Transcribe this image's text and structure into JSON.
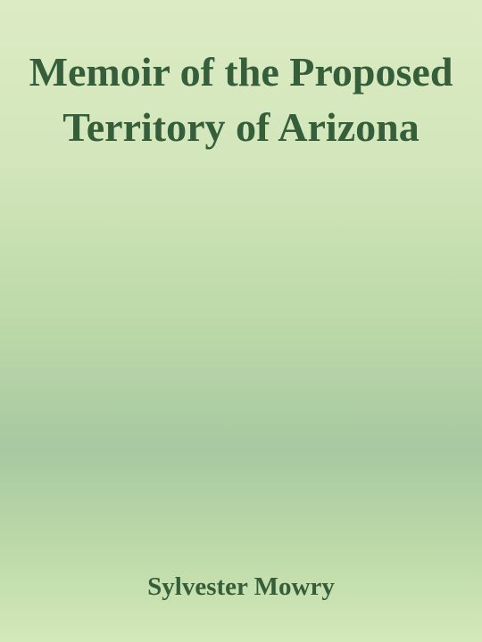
{
  "cover": {
    "title": "Memoir of the Proposed Territory of Arizona",
    "author": "Sylvester Mowry"
  }
}
